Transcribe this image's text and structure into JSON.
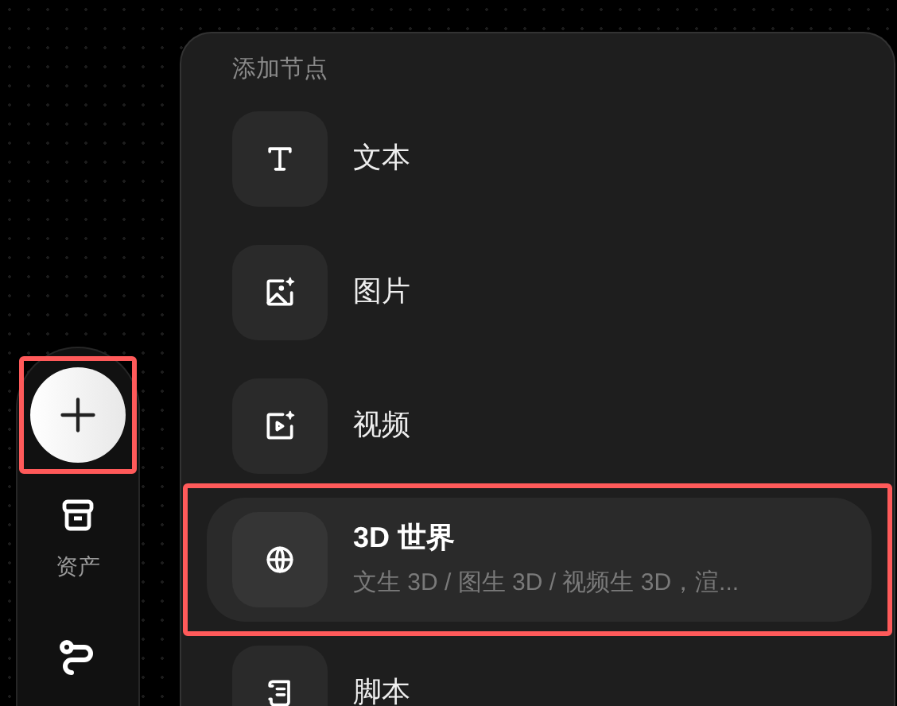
{
  "sidebar": {
    "items": [
      {
        "kind": "add",
        "highlighted": true
      },
      {
        "kind": "assets",
        "label": "资产"
      },
      {
        "kind": "workflow"
      }
    ]
  },
  "menu": {
    "title": "添加节点",
    "items": [
      {
        "kind": "text",
        "label": "文本",
        "selected": false,
        "highlighted": false
      },
      {
        "kind": "image",
        "label": "图片",
        "selected": false,
        "highlighted": false
      },
      {
        "kind": "video",
        "label": "视频",
        "selected": false,
        "highlighted": false
      },
      {
        "kind": "world",
        "label": "3D 世界",
        "description": "文生 3D / 图生 3D / 视频生 3D，渲...",
        "selected": true,
        "highlighted": true
      },
      {
        "kind": "script",
        "label": "脚本",
        "selected": false,
        "highlighted": false
      }
    ]
  }
}
